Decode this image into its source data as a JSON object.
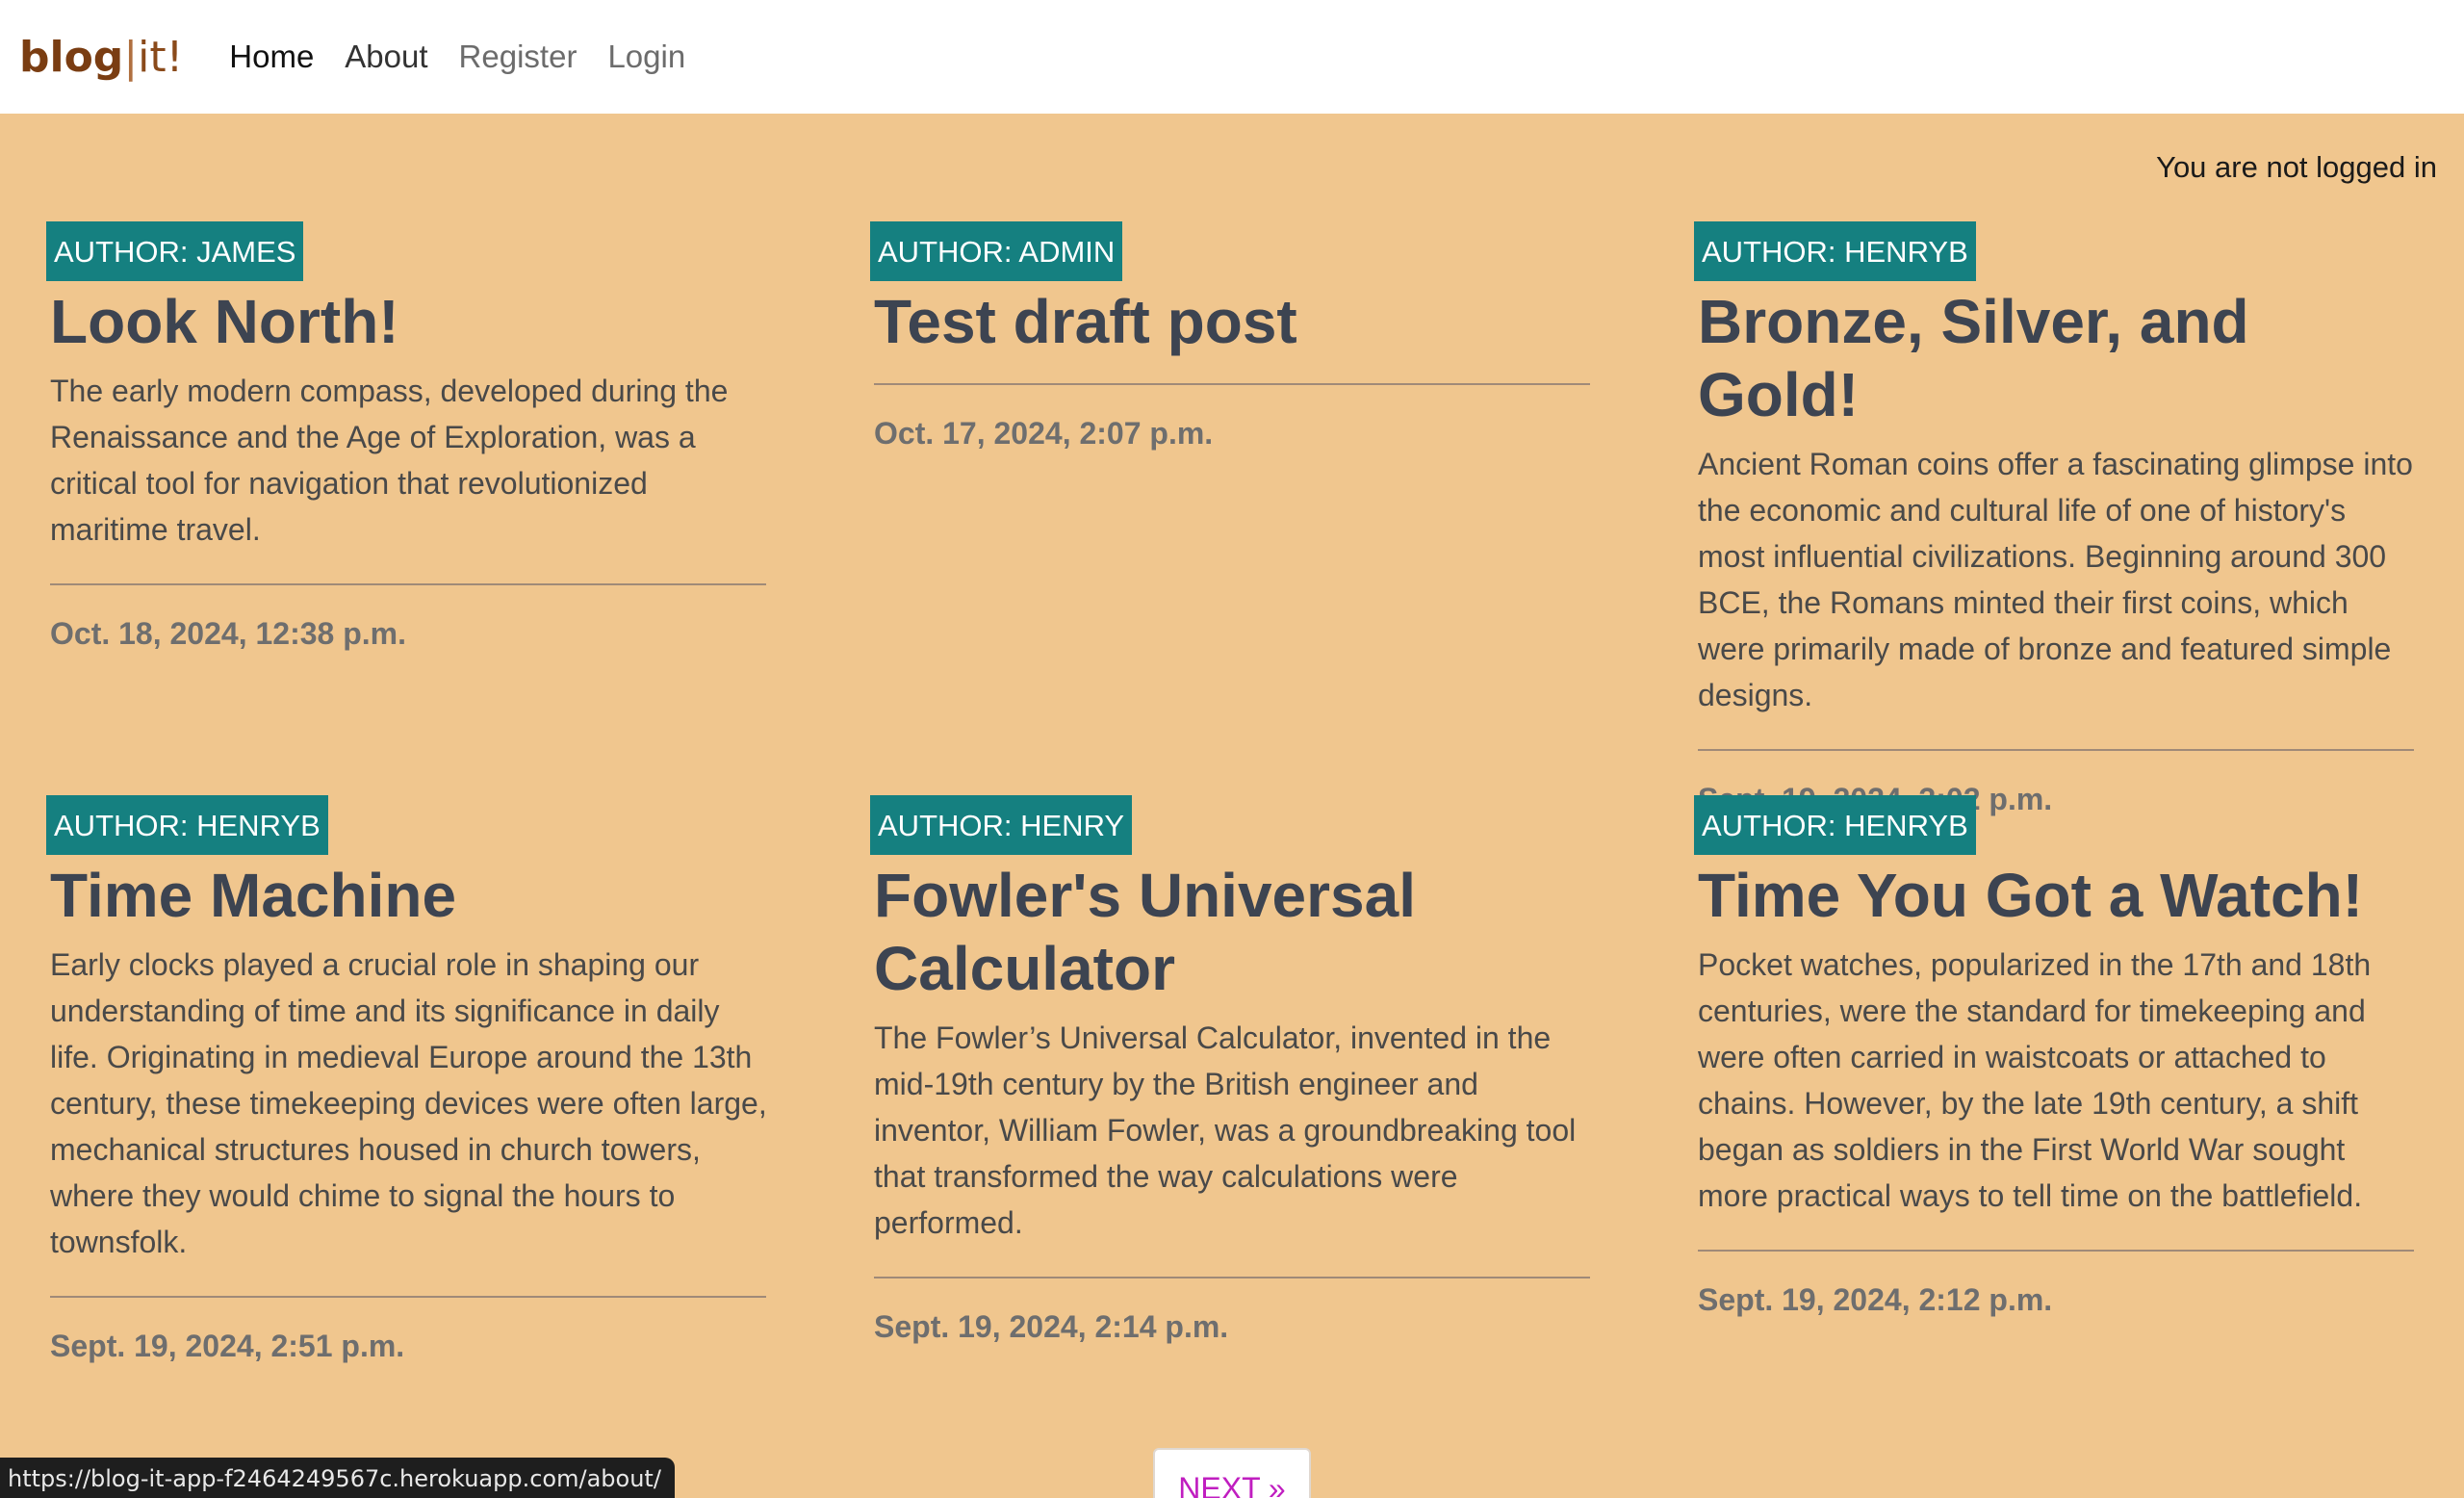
{
  "brand": {
    "blog": "blog",
    "sep": "|",
    "it": "it!"
  },
  "nav": {
    "home": "Home",
    "about": "About",
    "register": "Register",
    "login": "Login"
  },
  "login_status": "You are not logged in",
  "posts": [
    {
      "author": "AUTHOR: JAMES",
      "title": "Look North!",
      "excerpt": "The early modern compass, developed during the Renaissance and the Age of Exploration, was a critical tool for navigation that revolutionized maritime travel.",
      "date": "Oct. 18, 2024, 12:38 p.m."
    },
    {
      "author": "AUTHOR: ADMIN",
      "title": "Test draft post",
      "excerpt": "",
      "date": "Oct. 17, 2024, 2:07 p.m."
    },
    {
      "author": "AUTHOR: HENRYB",
      "title": "Bronze, Silver, and Gold!",
      "excerpt": "Ancient Roman coins offer a fascinating glimpse into the economic and cultural life of one of history's most influential civilizations. Beginning around 300 BCE, the Romans minted their first coins, which were primarily made of bronze and featured simple designs.",
      "date": "Sept. 19, 2024, 3:02 p.m."
    },
    {
      "author": "AUTHOR: HENRYB",
      "title": "Time Machine",
      "excerpt": "Early clocks played a crucial role in shaping our understanding of time and its significance in daily life. Originating in medieval Europe around the 13th century, these timekeeping devices were often large, mechanical structures housed in church towers, where they would chime to signal the hours to townsfolk.",
      "date": "Sept. 19, 2024, 2:51 p.m."
    },
    {
      "author": "AUTHOR: HENRY",
      "title": "Fowler's Universal Calculator",
      "excerpt": "The Fowler’s Universal Calculator, invented in the mid-19th century by the British engineer and inventor, William Fowler, was a groundbreaking tool that transformed the way calculations were performed.",
      "date": "Sept. 19, 2024, 2:14 p.m."
    },
    {
      "author": "AUTHOR: HENRYB",
      "title": "Time You Got a Watch!",
      "excerpt": "Pocket watches, popularized in the 17th and 18th centuries, were the standard for timekeeping and were often carried in waistcoats or attached to chains. However, by the late 19th century, a shift began as soldiers in the First World War sought more practical ways to tell time on the battlefield.",
      "date": "Sept. 19, 2024, 2:12 p.m."
    }
  ],
  "pagination": {
    "next": "NEXT »"
  },
  "status_bar": {
    "url": "https://blog-it-app-f2464249567c.herokuapp.com/about/"
  }
}
